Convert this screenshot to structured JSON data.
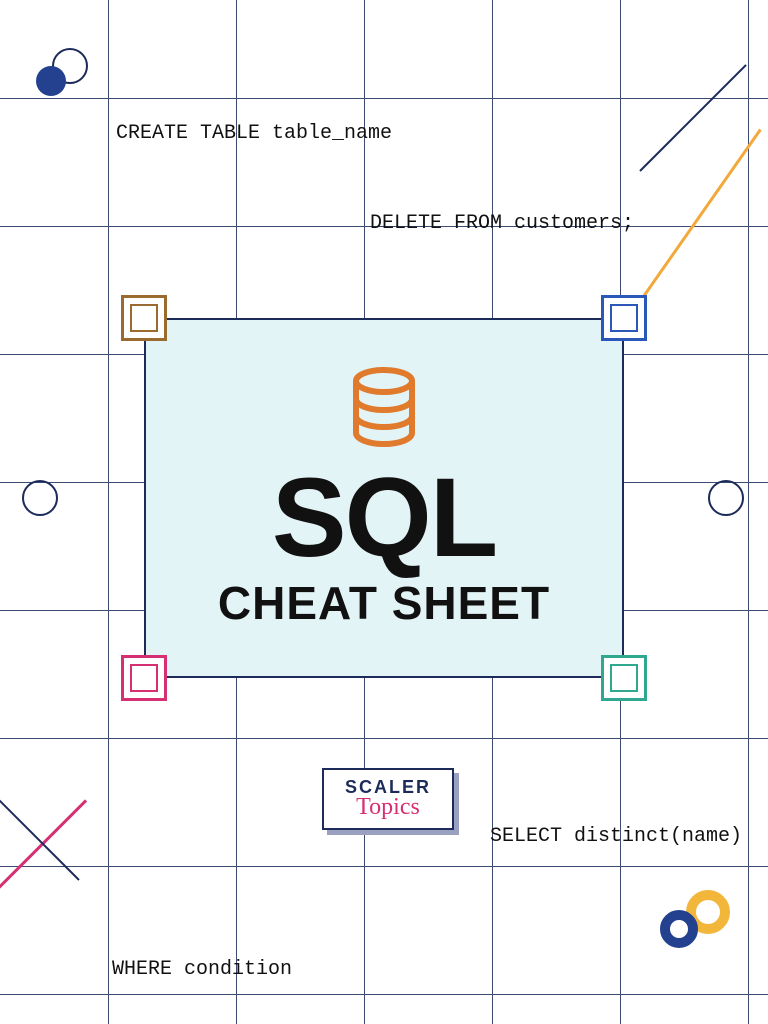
{
  "snippets": {
    "create_table": "CREATE TABLE table_name",
    "delete_from": "DELETE FROM customers;",
    "select_distinct": "SELECT distinct(name)",
    "where_condition": "WHERE condition"
  },
  "title": "SQL",
  "subtitle": "CHEAT SHEET",
  "logo": {
    "line1": "SCALER",
    "line2": "Topics"
  },
  "colors": {
    "grid": "#1c2b5a",
    "panel_bg": "#e3f4f7",
    "db_icon": "#e07a2d",
    "brand_blue": "#23418f",
    "brand_pink": "#d62f72",
    "accent_orange": "#f2a93a",
    "accent_teal": "#2fa88f",
    "accent_brown": "#9a6b2e"
  }
}
